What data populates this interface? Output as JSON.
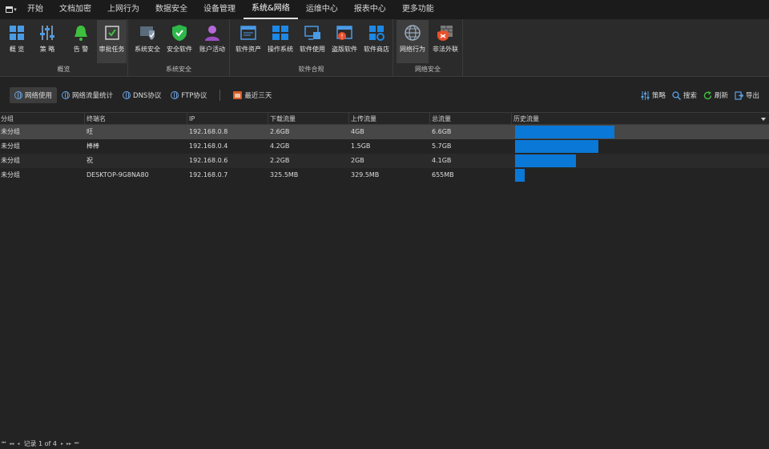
{
  "menu": {
    "items": [
      "开始",
      "文档加密",
      "上网行为",
      "数据安全",
      "设备管理",
      "系统&网络",
      "运维中心",
      "报表中心",
      "更多功能"
    ],
    "active_index": 5
  },
  "ribbon": {
    "groups": [
      {
        "label": "概览",
        "buttons": [
          {
            "label": "概 览",
            "icon": "grid-icon"
          },
          {
            "label": "策 略",
            "icon": "sliders-icon"
          },
          {
            "label": "告 警",
            "icon": "bell-icon"
          },
          {
            "label": "审批任务",
            "icon": "checkbox-icon",
            "selected": true
          }
        ]
      },
      {
        "label": "系统安全",
        "buttons": [
          {
            "label": "系统安全",
            "icon": "shield-computer-icon"
          },
          {
            "label": "安全软件",
            "icon": "shield-check-icon"
          },
          {
            "label": "账户活动",
            "icon": "user-icon"
          }
        ]
      },
      {
        "label": "软件合规",
        "buttons": [
          {
            "label": "软件资产",
            "icon": "window-icon"
          },
          {
            "label": "操作系统",
            "icon": "windows-logo-icon"
          },
          {
            "label": "软件使用",
            "icon": "monitor-icon"
          },
          {
            "label": "盗版软件",
            "icon": "piracy-icon"
          },
          {
            "label": "软件商店",
            "icon": "store-icon"
          }
        ]
      },
      {
        "label": "网络安全",
        "buttons": [
          {
            "label": "网络行为",
            "icon": "globe-icon",
            "selected": true
          },
          {
            "label": "非法外联",
            "icon": "firewall-icon"
          }
        ]
      }
    ]
  },
  "toolbar": {
    "tabs": [
      "网络使用",
      "网络流量统计",
      "DNS协议",
      "FTP协议"
    ],
    "active_tab": 0,
    "date_range": "最近三天",
    "actions": {
      "policy": "策略",
      "search": "搜索",
      "refresh": "刷新",
      "export": "导出"
    }
  },
  "table": {
    "columns": [
      "分组",
      "终端名",
      "IP",
      "下载流量",
      "上传流量",
      "总流量",
      "历史流量"
    ],
    "rows": [
      {
        "group": "未分组",
        "name": "旺",
        "ip": "192.168.0.8",
        "download": "2.6GB",
        "upload": "4GB",
        "total": "6.6GB",
        "history": 1.0
      },
      {
        "group": "未分组",
        "name": "棒棒",
        "ip": "192.168.0.4",
        "download": "4.2GB",
        "upload": "1.5GB",
        "total": "5.7GB",
        "history": 0.84
      },
      {
        "group": "未分组",
        "name": "祝",
        "ip": "192.168.0.6",
        "download": "2.2GB",
        "upload": "2GB",
        "total": "4.1GB",
        "history": 0.61
      },
      {
        "group": "未分组",
        "name": "DESKTOP-9G8NA80",
        "ip": "192.168.0.7",
        "download": "325.5MB",
        "upload": "329.5MB",
        "total": "655MB",
        "history": 0.1
      }
    ],
    "selected_row": 0,
    "bar_color": "#0a78d7"
  },
  "statusbar": {
    "record_text": "记录 1 of 4"
  }
}
